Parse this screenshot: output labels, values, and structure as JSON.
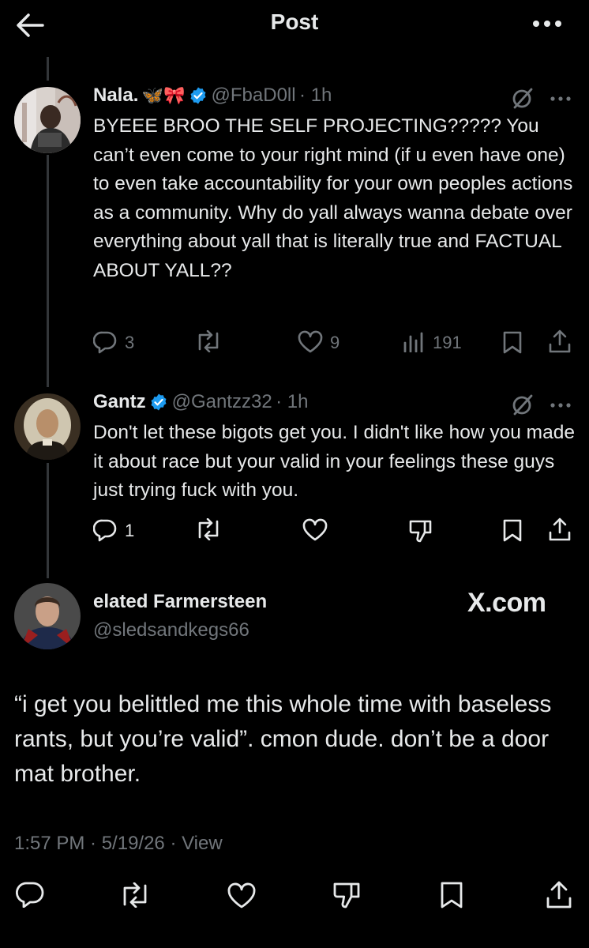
{
  "header": {
    "title": "Post"
  },
  "replies": [
    {
      "name": "Nala.",
      "emoji": "🦋🎀",
      "handle": "@FbaD0ll",
      "time": "· 1h",
      "text": "BYEEE BROO THE SELF PROJECTING????? You can’t even come to your right mind (if u even have one) to even take accountability for your own peoples actions as a community. Why do yall always wanna debate over everything about yall that is literally true and FACTUAL ABOUT YALL??",
      "replies_count": "3",
      "likes_count": "9",
      "views_count": "191"
    },
    {
      "name": "Gantz",
      "handle": "@Gantzz32",
      "time": "· 1h",
      "text": "Don't let these bigots get you.  I didn't like how you made it about race but your valid in your feelings these guys just trying fuck with you.",
      "replies_count": "1"
    }
  ],
  "main_post": {
    "name": "elated Farmersteen",
    "handle": "@sledsandkegs66",
    "watermark": "X.com",
    "text": "“i get you belittled me this whole time with baseless rants, but you’re valid”. cmon dude. don’t be a door mat brother.",
    "time": "1:57 PM · 5/19/26 · View"
  },
  "colors": {
    "background": "#000000",
    "text": "#e7e9ea",
    "muted": "#71767b",
    "verified": "#1d9bf0",
    "thread_line": "#333639"
  },
  "icons": [
    "back-arrow-icon",
    "more-icon",
    "grok-icon",
    "reply-icon",
    "retweet-icon",
    "like-icon",
    "views-icon",
    "bookmark-icon",
    "share-icon",
    "dislike-icon",
    "verified-icon"
  ]
}
